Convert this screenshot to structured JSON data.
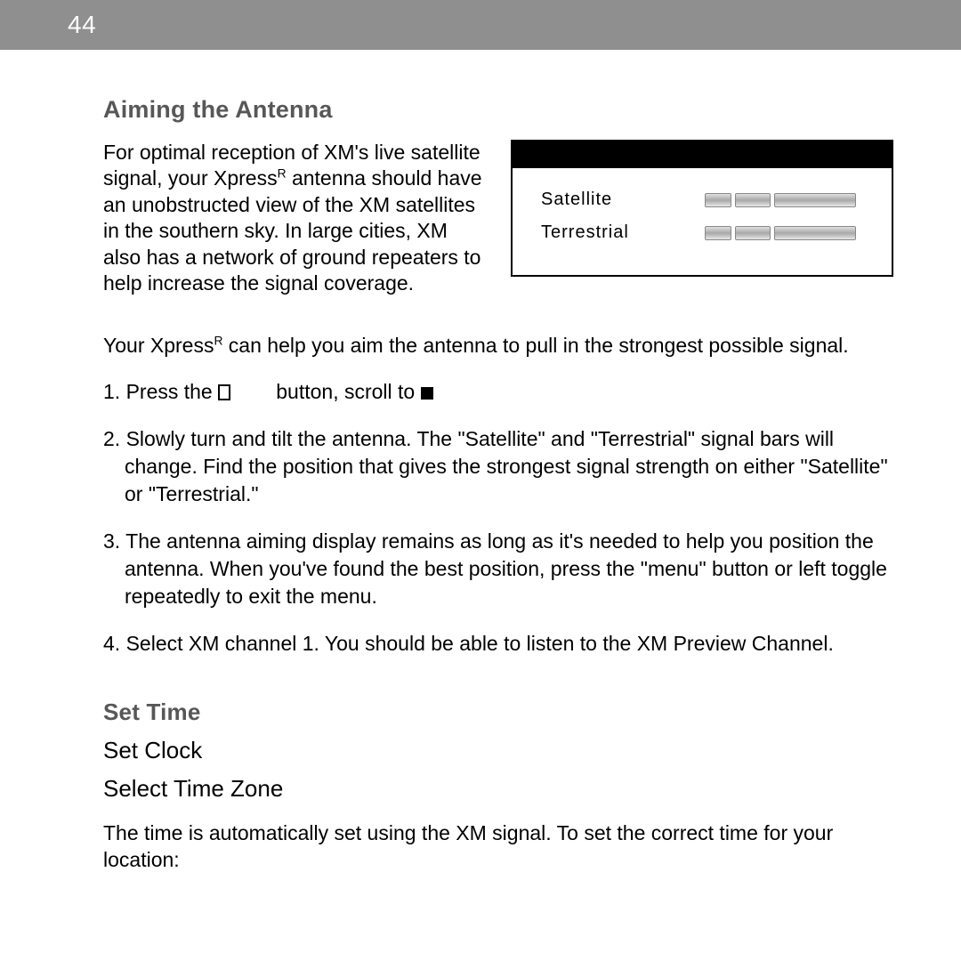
{
  "page_number": "44",
  "section1": {
    "title": "Aiming the Antenna",
    "intro_html": "For optimal reception of XM's live satellite signal, your Xpress<sup>R</sup> antenna should have an unobstructed view of the XM satellites in the southern sky. In large cities, XM also has a network of ground repeaters to help increase the signal coverage.",
    "figure": {
      "row1_label": "Satellite",
      "row2_label": "Terrestrial"
    },
    "lead_html": "Your Xpress<sup>R</sup> can help you aim the antenna to pull in the strongest possible signal.",
    "steps": [
      "1. Press the <span class=\"glyph\" data-name=\"menu-button-glyph\"></span>&nbsp;&nbsp;&nbsp;&nbsp;&nbsp;&nbsp;&nbsp; button, scroll to <span class=\"glyph-sq\" data-name=\"target-glyph\"></span>",
      "2. Slowly turn and tilt the antenna. The \"Satellite\" and \"Terrestrial\" signal bars will change.  Find the position that gives the strongest signal strength on either \"Satellite\" or \"Terrestrial.\"",
      "3. The antenna aiming display remains as long as it's needed to help you position the antenna. When you've found the best position, press the \"menu\" button or left toggle repeatedly to exit the menu.",
      "4. Select XM channel 1. You should be able to listen to the XM Preview Channel."
    ]
  },
  "section2": {
    "title": "Set Time",
    "sub1": "Set Clock",
    "sub2": "Select Time Zone",
    "body": "The time is automatically set using the XM signal. To set the correct time for your location:"
  }
}
